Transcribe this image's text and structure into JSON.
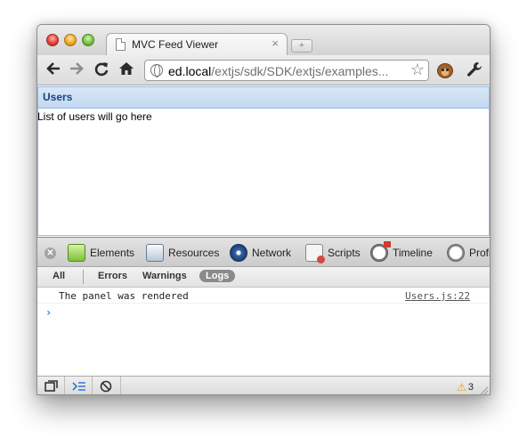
{
  "browser": {
    "tab_title": "MVC Feed Viewer",
    "tab_close": "×",
    "new_tab": "+",
    "url_host": "ed.local",
    "url_path": "/extjs/sdk/SDK/extjs/examples..."
  },
  "panel": {
    "title": "Users",
    "body_text": "List of users will go here"
  },
  "devtools": {
    "close_glyph": "✕",
    "tabs": [
      {
        "label": "Elements",
        "icon": "elements-icon"
      },
      {
        "label": "Resources",
        "icon": "resources-icon"
      },
      {
        "label": "Network",
        "icon": "network-icon"
      },
      {
        "label": "Scripts",
        "icon": "scripts-icon"
      },
      {
        "label": "Timeline",
        "icon": "timeline-icon"
      },
      {
        "label": "Profi",
        "icon": "profiles-icon"
      }
    ],
    "filters": {
      "all": "All",
      "errors": "Errors",
      "warnings": "Warnings",
      "logs": "Logs"
    },
    "console": {
      "messages": [
        {
          "text": "The panel was rendered",
          "source": "Users.js:22"
        }
      ],
      "prompt": "›"
    },
    "status": {
      "warning_count": "3"
    }
  },
  "colors": {
    "panel_header_text": "#15428b",
    "panel_border": "#99bbe8",
    "prompt": "#2b7bd6",
    "warning": "#f0a300"
  }
}
